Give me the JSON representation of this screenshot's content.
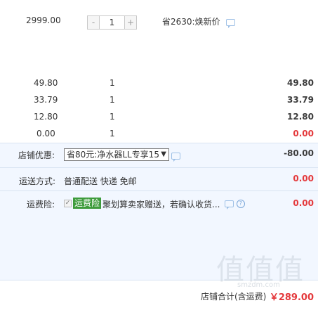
{
  "main_item": {
    "price": "2999.00",
    "quantity": "1",
    "minus": "-",
    "plus": "+",
    "promo": "省2630:焕新价"
  },
  "sub_items": [
    {
      "price": "49.80",
      "quantity": "1",
      "total": "49.80"
    },
    {
      "price": "33.79",
      "quantity": "1",
      "total": "33.79"
    },
    {
      "price": "12.80",
      "quantity": "1",
      "total": "12.80"
    },
    {
      "price": "0.00",
      "quantity": "1",
      "total": "0.00"
    }
  ],
  "store_discount": {
    "label": "店铺优惠:",
    "selected_option": "省80元:净水器LL专享15",
    "arrow": "▼",
    "amount": "-80.00"
  },
  "shipping": {
    "label": "运送方式:",
    "value": "普通配送 快递 免邮",
    "amount": "0.00"
  },
  "insurance": {
    "label": "运费险:",
    "checkbox": "✓",
    "badge": "运费险",
    "text": "聚划算卖家赠送，若确认收货...",
    "help": "?",
    "amount": "0.00"
  },
  "footer": {
    "label": "店铺合计(含运费)",
    "total": "￥289.00"
  },
  "watermark": {
    "main": "值值值",
    "sub": "smzdm.com"
  },
  "colors": {
    "accent_red": "#e4393c",
    "band_blue": "#f2f7ff",
    "badge_green": "#3d9b3b"
  }
}
